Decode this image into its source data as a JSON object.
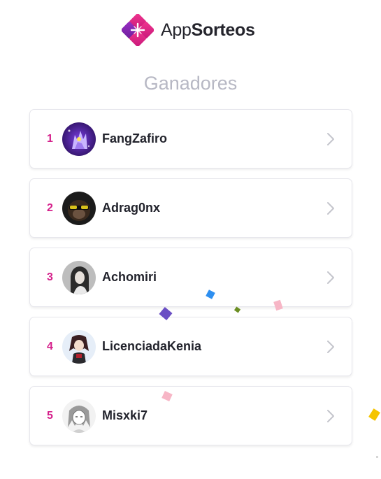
{
  "brand": {
    "name_light": "App",
    "name_bold": "Sorteos",
    "logo_icon": "appsorteos-logo-icon"
  },
  "page": {
    "title": "Ganadores"
  },
  "winners": [
    {
      "rank": "1",
      "username": "FangZafiro",
      "avatar": "purple-creature-avatar"
    },
    {
      "rank": "2",
      "username": "Adrag0nx",
      "avatar": "monkey-sunglasses-avatar"
    },
    {
      "rank": "3",
      "username": "Achomiri",
      "avatar": "woman-photo-avatar"
    },
    {
      "rank": "4",
      "username": "LicenciadaKenia",
      "avatar": "anime-character-avatar"
    },
    {
      "rank": "5",
      "username": "Misxki7",
      "avatar": "manga-sketch-avatar"
    }
  ],
  "colors": {
    "accent": "#d5208b",
    "brand_pink": "#e8308f",
    "brand_purple": "#8a2bb8",
    "title_gray": "#b7b8c4",
    "text_dark": "#22232c",
    "confetti": [
      "#6a4fc4",
      "#2e8ff0",
      "#6b8e23",
      "#f7b6c6",
      "#f5c400"
    ]
  }
}
